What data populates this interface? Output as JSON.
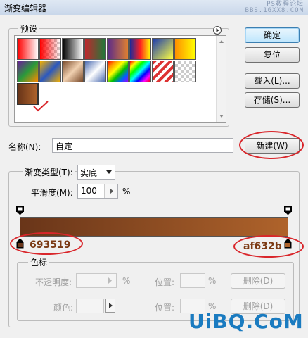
{
  "window": {
    "title": "渐变编辑器",
    "watermark_line1": "PS教程论坛",
    "watermark_line2": "BBS.16XX8.COM"
  },
  "presets": {
    "legend": "预设",
    "menu_icon": "arrow-right-circle-icon"
  },
  "buttons": {
    "ok": "确定",
    "reset": "复位",
    "load": "载入(L)...",
    "save": "存储(S)...",
    "new": "新建(W)"
  },
  "name": {
    "label": "名称(N):",
    "value": "自定"
  },
  "gradient_type": {
    "label": "渐变类型(T):",
    "value": "实底"
  },
  "smoothness": {
    "label": "平滑度(M):",
    "value": "100",
    "unit": "%"
  },
  "gradient": {
    "start_color": "#693519",
    "end_color": "#af632b"
  },
  "annotations": {
    "left_hex": "693519",
    "right_hex": "af632b"
  },
  "color_stops": {
    "legend": "色标",
    "opacity_label": "不透明度:",
    "opacity_unit": "%",
    "opacity_location_label": "位置:",
    "opacity_location_unit": "%",
    "opacity_delete": "删除(D)",
    "color_label": "颜色:",
    "color_location_label": "位置:",
    "color_location_unit": "%",
    "color_delete": "删除(D)"
  },
  "footer_watermark": "UiBQ.CoM"
}
